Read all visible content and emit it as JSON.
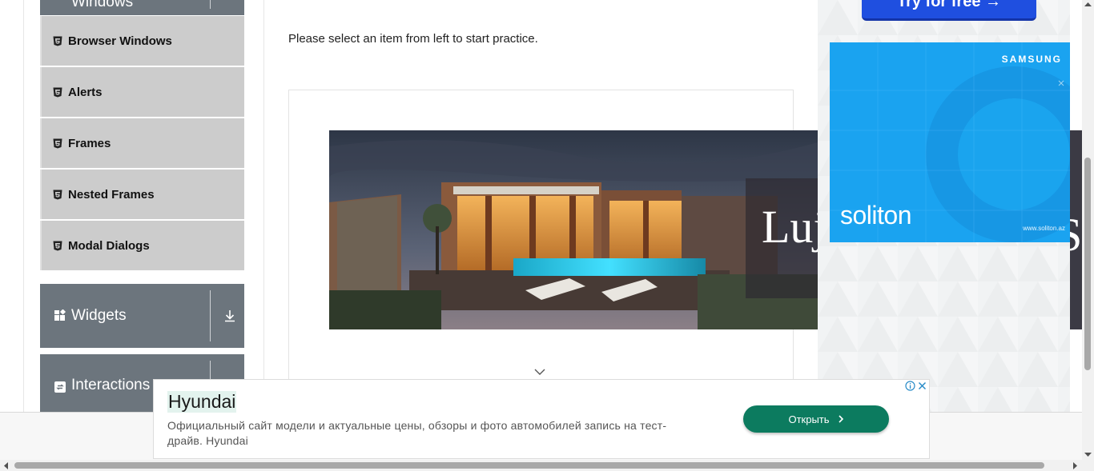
{
  "sidebar": {
    "windows_group": {
      "label": "Windows"
    },
    "menu_items": [
      {
        "label": "Browser Windows"
      },
      {
        "label": "Alerts"
      },
      {
        "label": "Frames"
      },
      {
        "label": "Nested Frames"
      },
      {
        "label": "Modal Dialogs"
      }
    ],
    "widgets_group": {
      "label": "Widgets"
    },
    "interactions_group": {
      "label": "Interactions"
    }
  },
  "main": {
    "practice_text": "Please select an item from left to start practice."
  },
  "right_ads": {
    "try_button": "Try for free  →",
    "samsung_brand": "SAMSUNG",
    "soliton_logo": "soliton",
    "soliton_url": "www.soliton.az"
  },
  "banner": {
    "brand_text": "Lujo"
  },
  "bottom_ad": {
    "title": "Hyundai",
    "description": "Официальный сайт модели и актуальные цены, обзоры и фото автомобилей запись на тест-драйв. Hyundai",
    "cta": "Открыть"
  },
  "colors": {
    "sidebar_group_bg": "#6c757d",
    "menu_item_bg": "#cccccc",
    "cta_green": "#0c7b5f",
    "try_blue": "#1f4fe0",
    "samsung_ad_blue": "#1aa3f0"
  }
}
